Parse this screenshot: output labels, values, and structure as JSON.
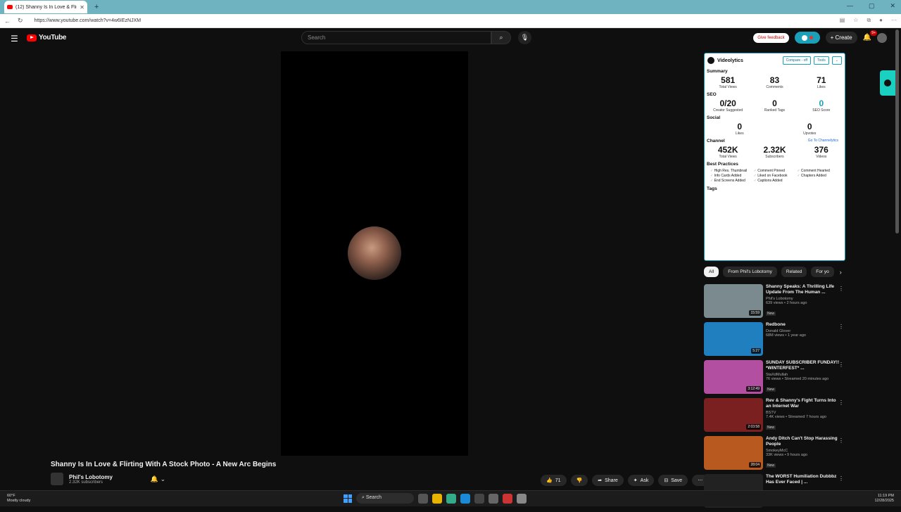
{
  "browser": {
    "tab_title": "(12) Shanny Is In Love & Flirting W...",
    "url": "https://www.youtube.com/watch?v=4w6IEzNJXM"
  },
  "header": {
    "logo_text": "YouTube",
    "search_placeholder": "Search",
    "feedback_label": "Give feedback",
    "create_label": "Create",
    "notif_count": "9+"
  },
  "video": {
    "title": "Shanny Is In Love & Flirting With A Stock Photo - A New Arc Begins",
    "channel": "Phil's Lobotomy",
    "subscribers": "2.32K subscribers",
    "likes": "71",
    "share_label": "Share",
    "ask_label": "Ask",
    "save_label": "Save"
  },
  "videolytics": {
    "brand": "Videolytics",
    "compare_label": "Compare - off",
    "tools_label": "Tools",
    "summary": {
      "label": "Summary",
      "items": [
        {
          "value": "581",
          "label": "Total Views"
        },
        {
          "value": "83",
          "label": "Comments"
        },
        {
          "value": "71",
          "label": "Likes"
        }
      ]
    },
    "seo": {
      "label": "SEO",
      "items": [
        {
          "value": "0/20",
          "label": "Creator Suggested"
        },
        {
          "value": "0",
          "label": "Ranked Tags"
        },
        {
          "value": "0",
          "label": "SEO Score"
        }
      ]
    },
    "social": {
      "label": "Social",
      "items": [
        {
          "value": "0",
          "label": "Likes"
        },
        {
          "value": "0",
          "label": "Upvotes"
        }
      ]
    },
    "channel": {
      "label": "Channel",
      "link": "Go To Channelytics",
      "items": [
        {
          "value": "452K",
          "label": "Total Views"
        },
        {
          "value": "2.32K",
          "label": "Subscribers"
        },
        {
          "value": "376",
          "label": "Videos"
        }
      ]
    },
    "best_practices": {
      "label": "Best Practices",
      "items": [
        "High Res. Thumbnail",
        "Comment Pinned",
        "Comment Hearted",
        "Info Cards Added",
        "Liked on Facebook",
        "Chapters Added",
        "End Screens Added",
        "Captions Added"
      ]
    },
    "tags_label": "Tags"
  },
  "chips": [
    "All",
    "From Phil's Lobotomy",
    "Related",
    "For yo"
  ],
  "recommendations": [
    {
      "title": "Shanny Speaks: A Thrilling Life Update From The Human ...",
      "channel": "Phil's Lobotomy",
      "meta": "639 views • 2 hours ago",
      "badge": "New",
      "duration": "15:59",
      "color": "#7a8a8e"
    },
    {
      "title": "Redbone",
      "channel": "Donald Glover",
      "meta": "68M views • 1 year ago",
      "badge": "",
      "duration": "5:27",
      "color": "#1f7fbf"
    },
    {
      "title": "SUNDAY SUBSCRIBER FUNDAY!! *WINTERFEST* ...",
      "channel": "StaXdMullah",
      "meta": "76 views • Streamed 20 minutes ago",
      "badge": "New",
      "duration": "3:12:49",
      "color": "#b24fa0"
    },
    {
      "title": "Rev & Shanny's Fight Turns Into an Internet War",
      "channel": "BSTV",
      "meta": "7.4K views • Streamed 7 hours ago",
      "badge": "New",
      "duration": "2:03:58",
      "color": "#7a2020"
    },
    {
      "title": "Andy Ditch Can't Stop Harassing People",
      "channel": "SmokeyMcC",
      "meta": "33K views • 9 hours ago",
      "badge": "New",
      "duration": "28:04",
      "color": "#b85a20"
    },
    {
      "title": "The WORST Humiliation Dubbbz Has Ever Faced | ...",
      "channel": "",
      "meta": "",
      "badge": "",
      "duration": "",
      "color": "#222"
    }
  ],
  "taskbar": {
    "weather_temp": "60°F",
    "weather_desc": "Mostly cloudy",
    "search_label": "Search",
    "time": "11:19 PM",
    "date": "12/28/2025"
  }
}
